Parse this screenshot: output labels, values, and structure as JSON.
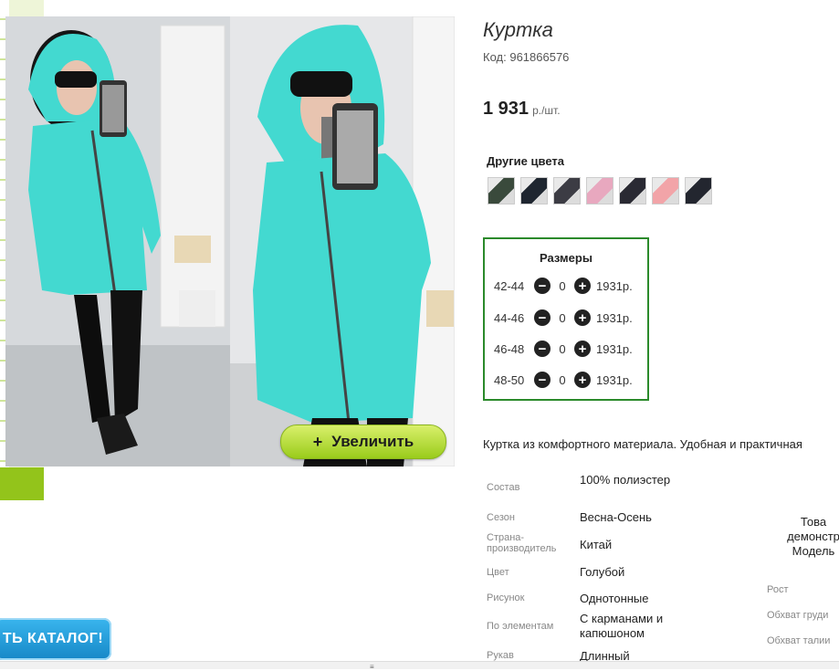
{
  "gallery": {
    "zoom_label": "Увеличить",
    "zoom_plus": "+"
  },
  "banner": {
    "catalog_label": "ТЬ КАТАЛОГ!"
  },
  "product": {
    "title": "Куртка",
    "code_label": "Код:",
    "code": "961866576",
    "price": "1 931",
    "price_unit": "р./шт.",
    "other_colors_label": "Другие цвета",
    "swatch_colors": [
      "#3a4a3c",
      "#1f2630",
      "#3c3c44",
      "#e8a8bf",
      "#2a2a33",
      "#f2a4a8",
      "#23262f"
    ],
    "description": "Куртка из комфортного материала. Удобная и практичная"
  },
  "sizes": {
    "title": "Размеры",
    "minus_glyph": "−",
    "plus_glyph": "+",
    "rows": [
      {
        "label": "42-44",
        "qty": "0",
        "price": "1931р."
      },
      {
        "label": "44-46",
        "qty": "0",
        "price": "1931р."
      },
      {
        "label": "46-48",
        "qty": "0",
        "price": "1931р."
      },
      {
        "label": "48-50",
        "qty": "0",
        "price": "1931р."
      }
    ]
  },
  "properties": [
    {
      "key": "Состав",
      "value": "100% полиэстер"
    },
    {
      "key": "Сезон",
      "value": "Весна-Осень"
    },
    {
      "key": "Страна-производитель",
      "value": "Китай"
    },
    {
      "key": "Цвет",
      "value": "Голубой"
    },
    {
      "key": "Рисунок",
      "value": "Однотонные"
    },
    {
      "key": "По элементам",
      "value": "С карманами и капюшоном"
    },
    {
      "key": "Рукав",
      "value": "Длинный"
    }
  ],
  "model": {
    "line1": "Това",
    "line2": "демонстр",
    "line3": "Модель",
    "height_label": "Рост",
    "chest_label": "Обхват груди",
    "waist_label": "Обхват талии"
  },
  "colors": {
    "accent_green": "#2b8a2b",
    "zoom_button": "#9acc1b",
    "catalog_blue": "#1687c7",
    "jacket_turquoise": "#43d9d0"
  },
  "scroll": {
    "grip": "≡"
  }
}
